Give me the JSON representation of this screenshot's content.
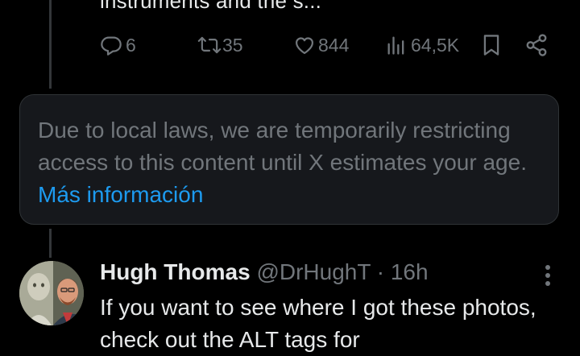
{
  "previous_tweet": {
    "truncated_text": "instruments and the s...",
    "actions": {
      "replies": "6",
      "reposts": "35",
      "likes": "844",
      "views": "64,5K"
    }
  },
  "restriction_notice": {
    "message": "Due to local laws, we are temporarily restricting access to this content until X estimates your age.",
    "link_text": "Más información"
  },
  "reply_tweet": {
    "author_name": "Hugh Thomas",
    "handle": "@DrHughT",
    "separator": "·",
    "time": "16h",
    "text": "If you want to see where I got these photos, check out the ALT tags for"
  },
  "colors": {
    "background": "#000000",
    "text_primary": "#e7e9ea",
    "text_secondary": "#71767b",
    "link": "#1d9bf0",
    "card_background": "#16181c",
    "thread_line": "#333639"
  }
}
